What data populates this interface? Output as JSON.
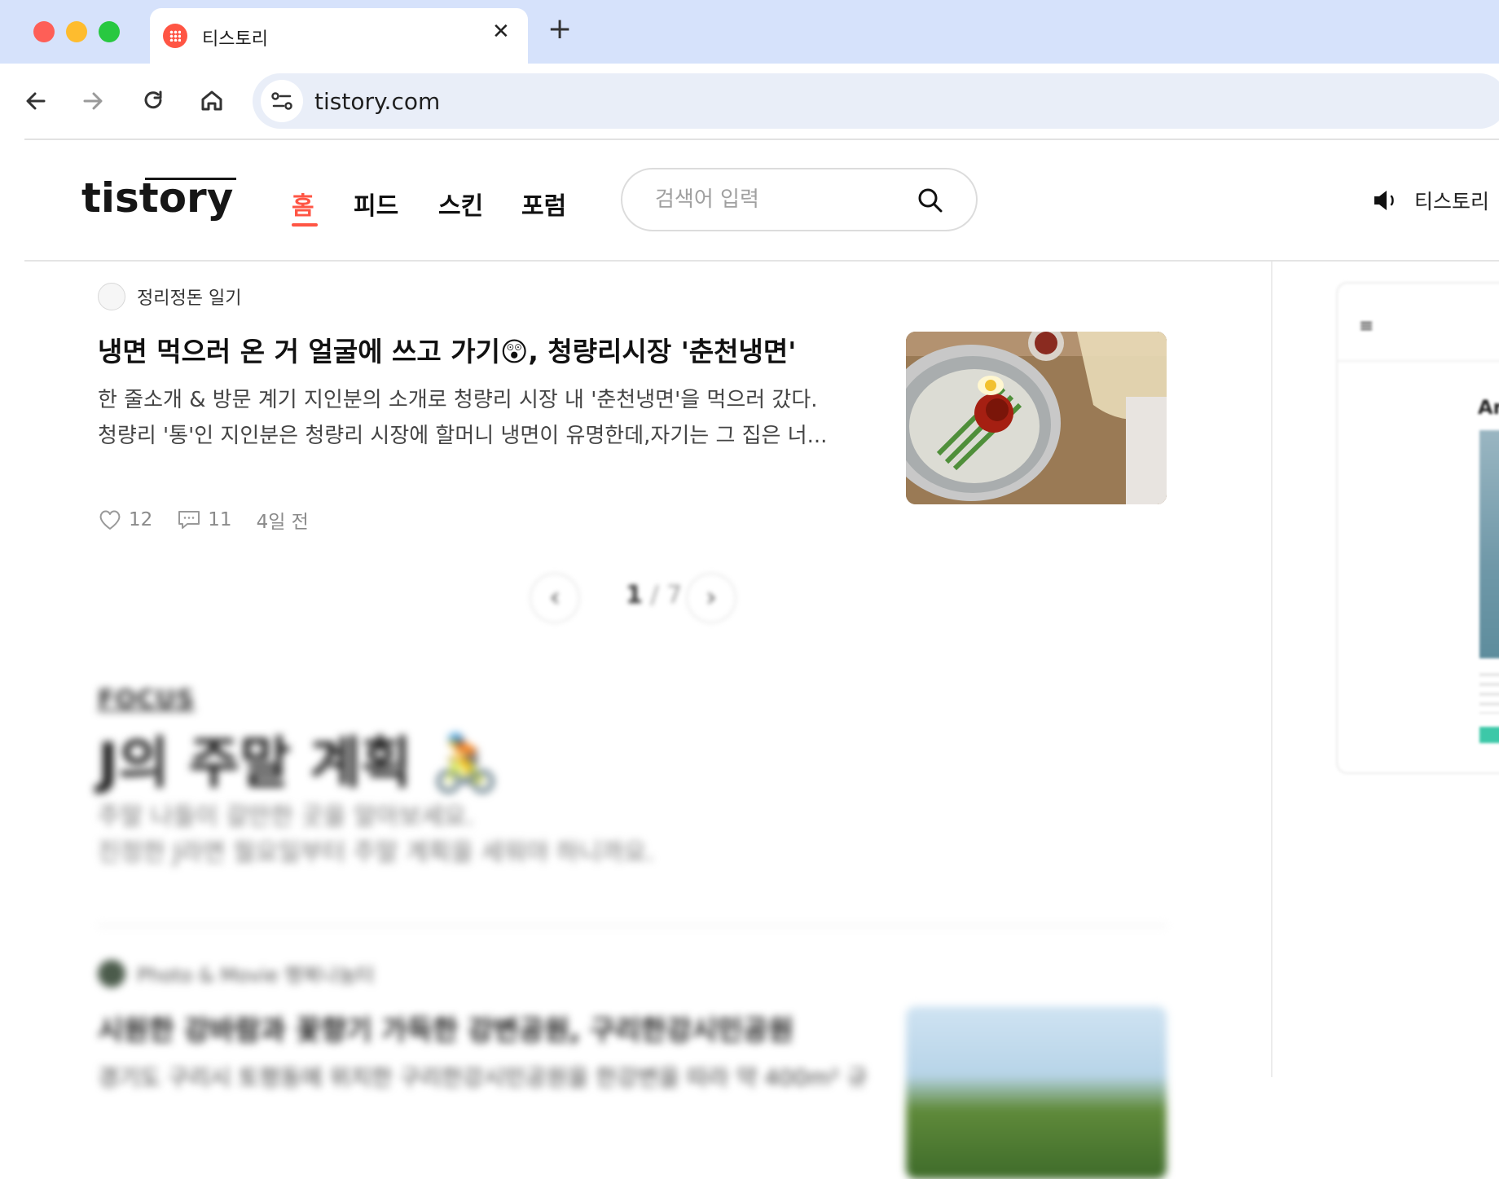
{
  "browser": {
    "tab_title": "티스토리",
    "tab_close": "✕",
    "new_tab": "+",
    "url": "tistory.com"
  },
  "header": {
    "logo": "tistory",
    "nav": [
      {
        "label": "홈",
        "active": true
      },
      {
        "label": "피드"
      },
      {
        "label": "스킨"
      },
      {
        "label": "포럼"
      }
    ],
    "search_placeholder": "검색어 입력",
    "notice": "티스토리 "
  },
  "post": {
    "blog_name": "정리정돈 일기",
    "title": "냉면 먹으러 온 거 얼굴에 쓰고 가기😲, 청량리시장 '춘천냉면'",
    "excerpt_line1": "한 줄소개 & 방문 계기 지인분의 소개로 청량리 시장 내 '춘천냉면'을 먹으러 갔다.",
    "excerpt_line2": "청량리 '통'인 지인분은 청량리 시장에 할머니 냉면이 유명한데,자기는 그 집은 너...",
    "likes": "12",
    "comments": "11",
    "time": "4일 전"
  },
  "pager": {
    "current": "1",
    "separator": " / ",
    "total": "7",
    "prev": "‹",
    "next": "›"
  },
  "focus": {
    "label": "FOCUS",
    "title": "J의 주말 계획 🚴",
    "desc_line1": "주말 나들이 갈만한 곳을 알아보세요.",
    "desc_line2": "진정한 J라면 월요일부터 주말 계획을 세워야 하니까요."
  },
  "post2": {
    "blog_name": "Photo & Movie 행복나눔터",
    "title": "시원한 강바람과 꽃향기 가득한 강변공원, 구리한강시민공원",
    "excerpt": "경기도 구리시 토평동에 위치한 구리한강시민공원을 한강변을 따라 약 400m² 규"
  },
  "sidebar": {
    "menu_icon": "≡",
    "text": "Ar"
  }
}
